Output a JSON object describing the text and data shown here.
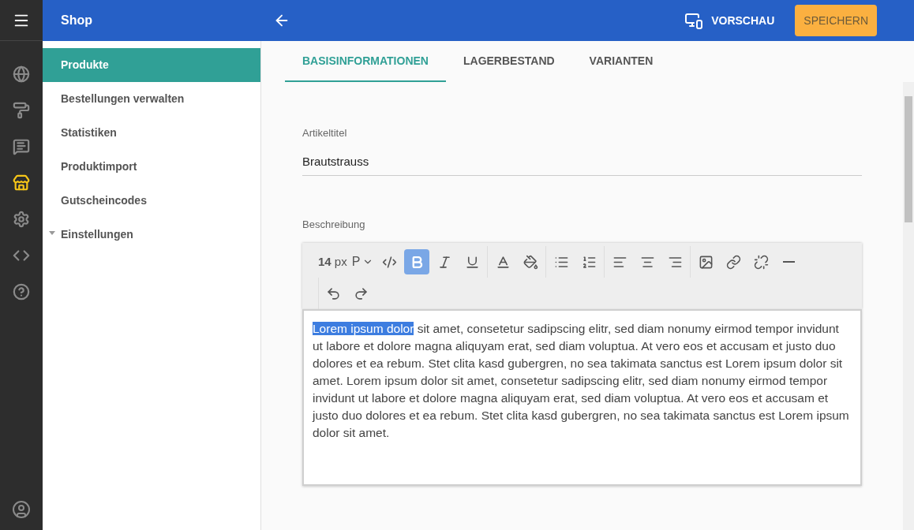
{
  "rail": {
    "items": [
      {
        "kind": "globe",
        "selected": false
      },
      {
        "kind": "roller",
        "selected": false
      },
      {
        "kind": "review",
        "selected": false
      },
      {
        "kind": "store",
        "selected": true
      },
      {
        "kind": "settings",
        "selected": false
      },
      {
        "kind": "code",
        "selected": false
      },
      {
        "kind": "help",
        "selected": false
      }
    ]
  },
  "header": {
    "title": "Shop",
    "preview": "VORSCHAU",
    "save": "SPEICHERN"
  },
  "sidebar": {
    "items": [
      {
        "label": "Produkte",
        "selected": true
      },
      {
        "label": "Bestellungen verwalten",
        "selected": false
      },
      {
        "label": "Statistiken",
        "selected": false
      },
      {
        "label": "Produktimport",
        "selected": false
      },
      {
        "label": "Gutscheincodes",
        "selected": false
      },
      {
        "label": "Einstellungen",
        "selected": false,
        "expanded": false
      }
    ]
  },
  "tabs": [
    {
      "label": "BASISINFORMATIONEN",
      "selected": true
    },
    {
      "label": "LAGERBESTAND",
      "selected": false
    },
    {
      "label": "VARIANTEN",
      "selected": false
    }
  ],
  "form": {
    "title_label": "Artikeltitel",
    "title_value": "Brautstrauss",
    "description_label": "Beschreibung"
  },
  "toolbar": {
    "font_size": "14",
    "font_unit": "px",
    "block": "P",
    "groups": [
      [
        {
          "kind": "code",
          "active": false
        },
        {
          "kind": "bold",
          "active": true
        },
        {
          "kind": "italic",
          "active": false
        },
        {
          "kind": "underline",
          "active": false
        }
      ],
      [
        {
          "kind": "color",
          "active": false
        },
        {
          "kind": "fill",
          "active": false
        }
      ],
      [
        {
          "kind": "bullets",
          "active": false
        },
        {
          "kind": "numbers",
          "active": false
        }
      ],
      [
        {
          "kind": "left",
          "active": false
        },
        {
          "kind": "center",
          "active": false
        },
        {
          "kind": "right",
          "active": false
        }
      ],
      [
        {
          "kind": "image",
          "active": false
        },
        {
          "kind": "link",
          "active": false
        },
        {
          "kind": "unlink",
          "active": false
        },
        {
          "kind": "rule",
          "active": false
        }
      ],
      [
        {
          "kind": "undo",
          "active": false
        },
        {
          "kind": "redo",
          "active": false
        }
      ]
    ]
  },
  "editor": {
    "selected_text": "Lorem ipsum dolor",
    "text": " sit amet, consetetur sadipscing elitr, sed diam nonumy eirmod tempor invidunt ut labore et dolore magna aliquyam erat, sed diam voluptua. At vero eos et accusam et justo duo dolores et ea rebum. Stet clita kasd gubergren, no sea takimata sanctus est Lorem ipsum dolor sit amet. Lorem ipsum dolor sit amet, consetetur sadipscing elitr, sed diam nonumy eirmod tempor invidunt ut labore et dolore magna aliquyam erat, sed diam voluptua. At vero eos et accusam et justo duo dolores et ea rebum. Stet clita kasd gubergren, no sea takimata sanctus est Lorem ipsum dolor sit amet."
  }
}
